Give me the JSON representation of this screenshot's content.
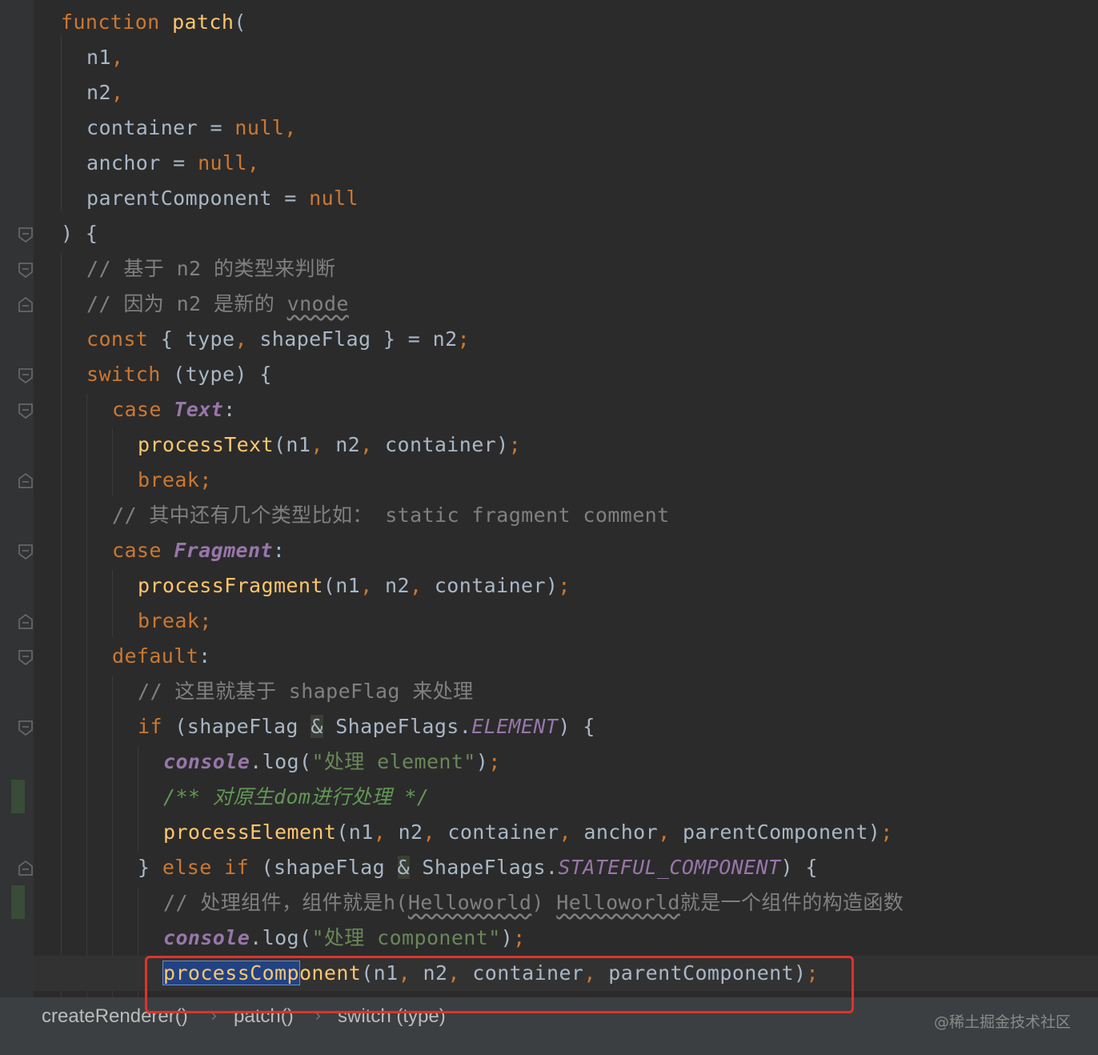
{
  "code": {
    "l01": {
      "a": "function",
      "b": " ",
      "c": "patch",
      "d": "("
    },
    "l02": {
      "a": "n1",
      "b": ","
    },
    "l03": {
      "a": "n2",
      "b": ","
    },
    "l04": {
      "a": "container = ",
      "b": "null",
      "c": ","
    },
    "l05": {
      "a": "anchor = ",
      "b": "null",
      "c": ","
    },
    "l06": {
      "a": "parentComponent = ",
      "b": "null"
    },
    "l07": {
      "a": ") {"
    },
    "l08": {
      "a": "// 基于 n2 的类型来判断"
    },
    "l09": {
      "a": "// 因为 n2 是新的 ",
      "b": "vnode"
    },
    "l10": {
      "a": "const",
      "b": " { type",
      "c": ",",
      "d": " shapeFlag } = n2",
      "e": ";"
    },
    "l11": {
      "a": "switch",
      "b": " (type) {"
    },
    "l12": {
      "a": "case",
      "b": " ",
      "c": "Text",
      "d": ":"
    },
    "l13": {
      "a": "processText",
      "b": "(n1",
      "c": ",",
      "d": " n2",
      "e": ",",
      "f": " container)",
      "g": ";"
    },
    "l14": {
      "a": "break;"
    },
    "l15": {
      "a": "// 其中还有几个类型比如： static fragment comment"
    },
    "l16": {
      "a": "case",
      "b": " ",
      "c": "Fragment",
      "d": ":"
    },
    "l17": {
      "a": "processFragment",
      "b": "(n1",
      "c": ",",
      "d": " n2",
      "e": ",",
      "f": " container)",
      "g": ";"
    },
    "l18": {
      "a": "break;"
    },
    "l19": {
      "a": "default",
      "b": ":"
    },
    "l20": {
      "a": "// 这里就基于 shapeFlag 来处理"
    },
    "l21": {
      "a": "if",
      "b": " (shapeFlag ",
      "c": "&",
      "d": " ShapeFlags.",
      "e": "ELEMENT",
      "f": ") {"
    },
    "l22": {
      "a": "console",
      "b": ".log(",
      "c": "\"处理 element\"",
      "d": ")",
      "e": ";"
    },
    "l23": {
      "a": "/** 对原生dom进行处理 */"
    },
    "l24": {
      "a": "processElement",
      "b": "(n1",
      "c": ",",
      "d": " n2",
      "e": ",",
      "f": " container",
      "g": ",",
      "h": " anchor",
      "i": ",",
      "j": " parentComponent)",
      "k": ";"
    },
    "l25": {
      "a": "} ",
      "b": "else if",
      "c": " (shapeFlag ",
      "d": "&",
      "e": " ShapeFlags.",
      "f": "STATEFUL_COMPONENT",
      "g": ") {"
    },
    "l26": {
      "a": "// 处理组件，组件就是h(",
      "b": "Helloworld",
      "c": ") ",
      "d": "Helloworld",
      "e": "就是一个组件的构造函数"
    },
    "l27": {
      "a": "console",
      "b": ".log(",
      "c": "\"处理 component\"",
      "d": ")",
      "e": ";"
    },
    "l28": {
      "a": "processComp",
      "b": "onent",
      "c": "(n1",
      "d": ",",
      "e": " n2",
      "f": ",",
      "g": " container",
      "h": ",",
      "i": " parentComponent)",
      "j": ";"
    }
  },
  "breadcrumb": {
    "items": [
      "createRenderer()",
      "patch()",
      "switch (type)"
    ],
    "separator": "›"
  },
  "watermark": "@稀土掘金技术社区",
  "colors": {
    "keyword": "#cc7832",
    "function": "#ffc66d",
    "comment": "#808080",
    "doc_comment": "#629755",
    "string": "#6a8759",
    "constant": "#9876aa",
    "highlight_box": "#e0322a"
  }
}
